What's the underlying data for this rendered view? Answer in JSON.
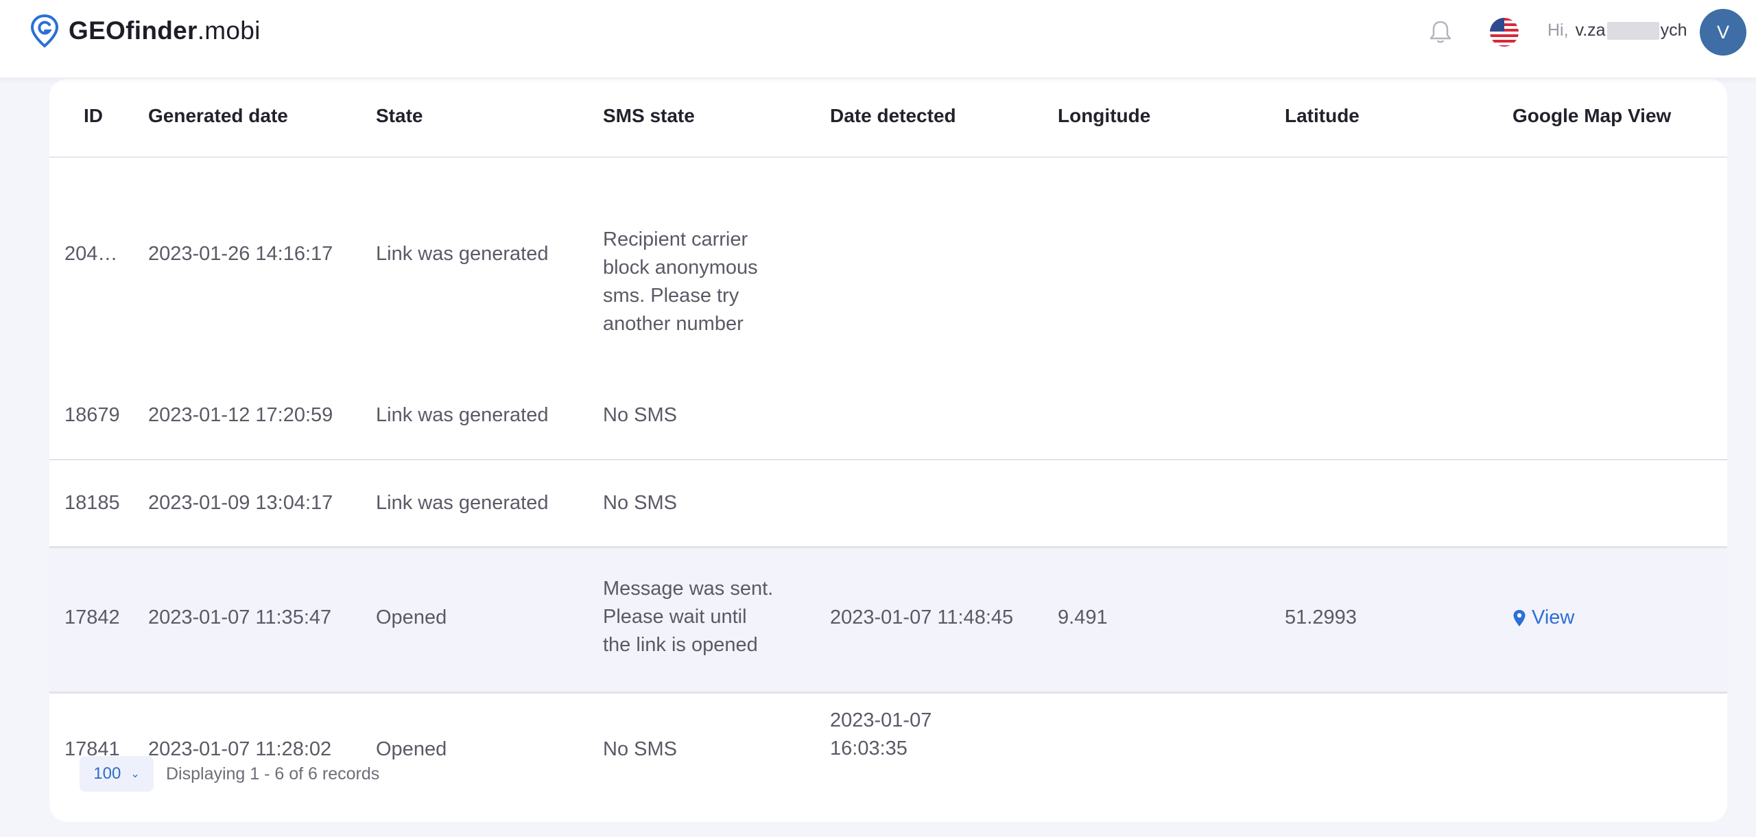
{
  "brand": {
    "bold": "GEOfinder",
    "light": ".mobi"
  },
  "header": {
    "greeting": "Hi,",
    "user_part1": "v.za",
    "user_part2": "ych",
    "avatar_initial": "V"
  },
  "table": {
    "columns": [
      "ID",
      "Generated date",
      "State",
      "SMS state",
      "Date detected",
      "Longitude",
      "Latitude",
      "Google Map View"
    ],
    "rows": [
      {
        "id": "204…",
        "generated": "2023-01-26 14:16:17",
        "state": "Link was generated",
        "sms_lines": [
          "Recipient carrier",
          "block anonymous",
          "sms. Please try",
          "another number"
        ],
        "detected_lines": [],
        "longitude": "",
        "latitude": "",
        "map": ""
      },
      {
        "id": "18679",
        "generated": "2023-01-12 17:20:59",
        "state": "Link was generated",
        "sms_lines": [
          "No SMS"
        ],
        "detected_lines": [],
        "longitude": "",
        "latitude": "",
        "map": ""
      },
      {
        "id": "18185",
        "generated": "2023-01-09 13:04:17",
        "state": "Link was generated",
        "sms_lines": [
          "No SMS"
        ],
        "detected_lines": [],
        "longitude": "",
        "latitude": "",
        "map": ""
      },
      {
        "id": "17842",
        "generated": "2023-01-07 11:35:47",
        "state": "Opened",
        "sms_lines": [
          "Message was sent.",
          "Please wait until",
          "the link is opened"
        ],
        "detected_lines": [
          "2023-01-07 11:48:45"
        ],
        "longitude": "9.491",
        "latitude": "51.2993",
        "map": "View"
      },
      {
        "id": "17841",
        "generated": "2023-01-07 11:28:02",
        "state": "Opened",
        "sms_lines": [
          "No SMS"
        ],
        "detected_lines": [
          "2023-01-07",
          "16:03:35"
        ],
        "longitude": "",
        "latitude": "",
        "map": ""
      }
    ]
  },
  "pagination": {
    "page_size": "100",
    "summary": "Displaying 1 - 6 of 6 records"
  },
  "colors": {
    "accent": "#2b6fd6",
    "avatar": "#3e6ea5",
    "highlight_row": "#f3f3fc",
    "background": "#f4f5fa"
  },
  "icons": {
    "logo": "location-pin-icon",
    "notifications": "bell-icon",
    "language": "us-flag-icon",
    "map": "map-pin-icon",
    "dropdown": "chevron-down-icon"
  }
}
